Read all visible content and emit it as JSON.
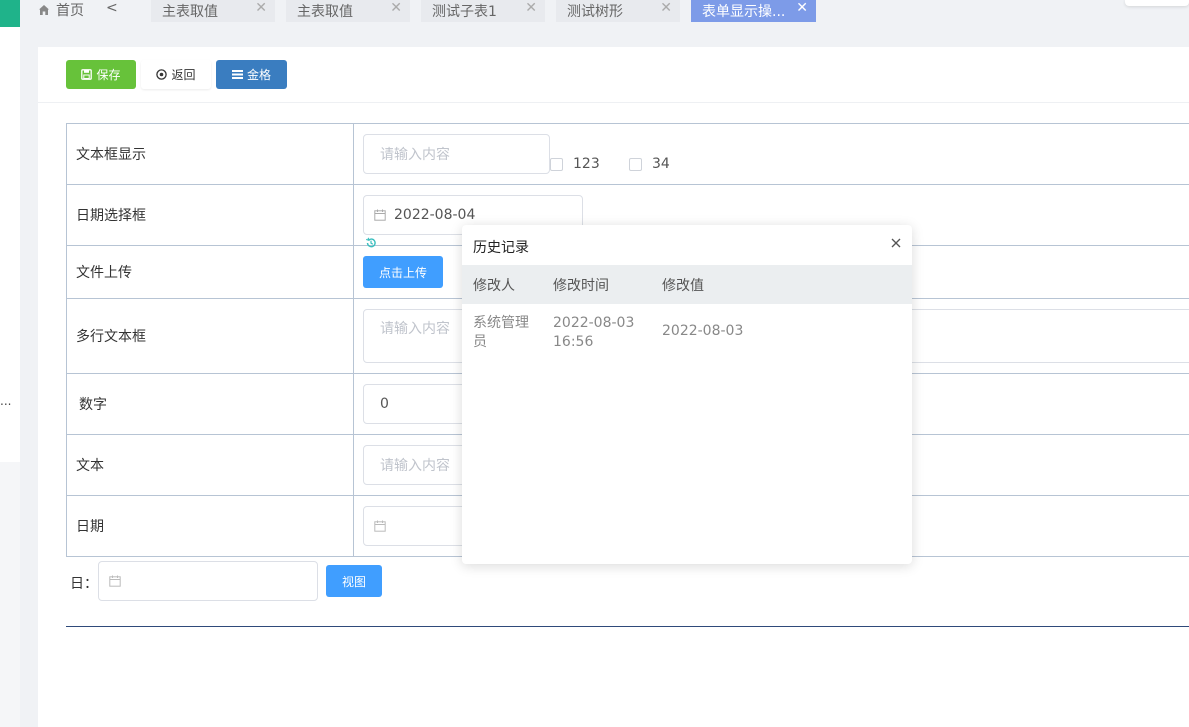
{
  "tabs": {
    "home_label": "首页",
    "prev_label": "<",
    "items": [
      {
        "label": "主表取值",
        "close": "✕"
      },
      {
        "label": "主表取值",
        "close": "✕"
      },
      {
        "label": "测试子表1",
        "close": "✕"
      },
      {
        "label": "测试树形",
        "close": "✕"
      },
      {
        "label": "表单显示操...",
        "close": "✕"
      }
    ]
  },
  "sidebar": {
    "overflow_text": "..."
  },
  "toolbar": {
    "save_label": "保存",
    "back_label": "返回",
    "grid_label": "金格"
  },
  "form": {
    "rows": [
      {
        "label": "文本框显示",
        "placeholder": "请输入内容"
      },
      {
        "label": "日期选择框",
        "value": "2022-08-04"
      },
      {
        "label": "文件上传",
        "button": "点击上传"
      },
      {
        "label": "多行文本框",
        "placeholder": "请输入内容"
      },
      {
        "label": "数字",
        "value": "0"
      },
      {
        "label": "文本",
        "placeholder": "请输入内容"
      },
      {
        "label": "日期"
      }
    ],
    "checkboxes": [
      {
        "label": "123",
        "checked": false
      },
      {
        "label": "34",
        "checked": false
      }
    ]
  },
  "filter": {
    "label": "日：",
    "view_button": "视图"
  },
  "history_popup": {
    "title": "历史记录",
    "columns": [
      "修改人",
      "修改时间",
      "修改值"
    ],
    "rows": [
      {
        "user": "系统管理员",
        "time": "2022-08-03 16:56",
        "value": "2022-08-03"
      }
    ]
  },
  "colors": {
    "save": "#67c23a",
    "grid": "#3a7dc0",
    "primary": "#409eff",
    "active_tab": "#7d9be8",
    "sidebar_accent": "#1fb38a"
  }
}
